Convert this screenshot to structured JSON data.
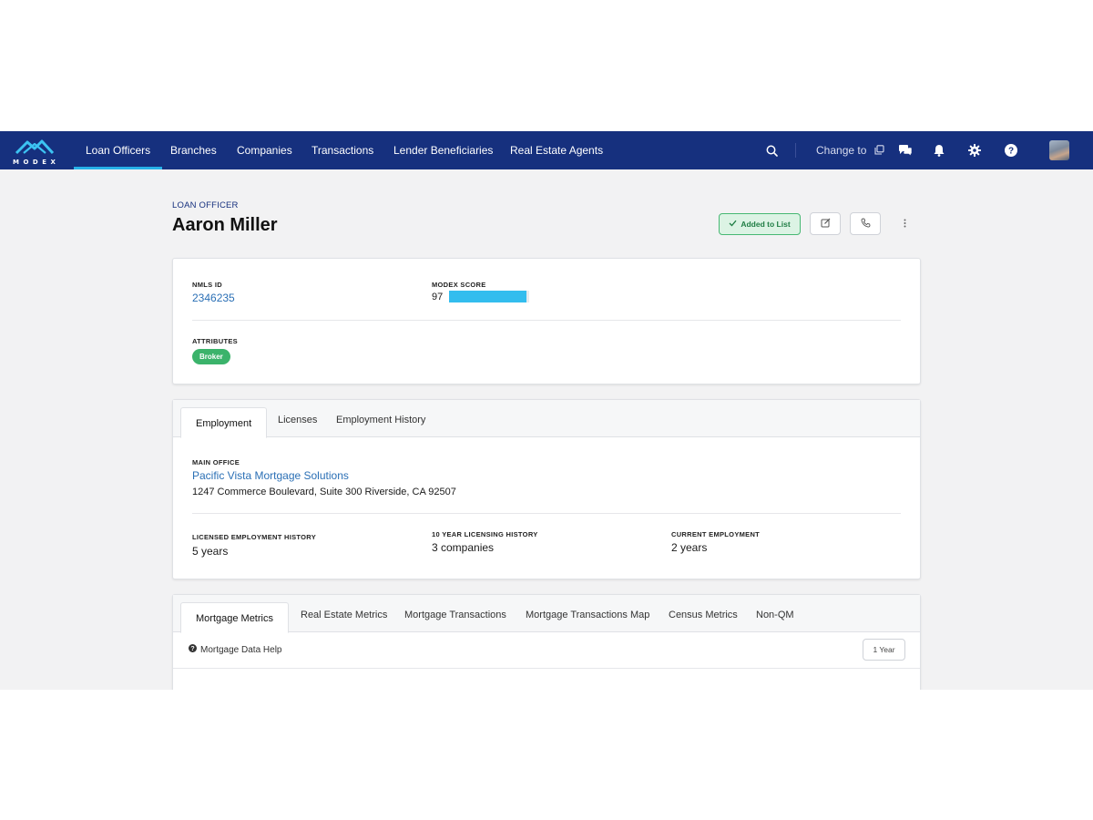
{
  "brand": {
    "name": "MODEX"
  },
  "nav": {
    "items": [
      {
        "label": "Loan Officers",
        "active": true
      },
      {
        "label": "Branches"
      },
      {
        "label": "Companies"
      },
      {
        "label": "Transactions"
      },
      {
        "label": "Lender Beneficiaries"
      },
      {
        "label": "Real Estate Agents"
      }
    ],
    "change_to": "Change to",
    "icons": [
      "search-icon",
      "copy-icon",
      "chat-icon",
      "bell-icon",
      "gear-icon",
      "help-icon"
    ]
  },
  "header": {
    "kicker": "LOAN OFFICER",
    "name": "Aaron Miller",
    "added_label": "Added to List"
  },
  "summary": {
    "nmls_label": "NMLS ID",
    "nmls_id": "2346235",
    "score_label": "MODEX SCORE",
    "score": "97",
    "score_fraction": 0.97,
    "attributes_label": "ATTRIBUTES",
    "attributes": [
      "Broker"
    ]
  },
  "employment": {
    "tabs": [
      "Employment",
      "Licenses",
      "Employment History"
    ],
    "main_office_label": "MAIN OFFICE",
    "office_name": "Pacific Vista Mortgage Solutions",
    "office_address": "1247 Commerce Boulevard, Suite 300 Riverside, CA 92507",
    "stats": [
      {
        "label": "LICENSED EMPLOYMENT HISTORY",
        "value": "5 years"
      },
      {
        "label": "10 YEAR LICENSING HISTORY",
        "value": "3 companies"
      },
      {
        "label": "CURRENT EMPLOYMENT",
        "value": "2 years"
      }
    ]
  },
  "metrics": {
    "tabs": [
      "Mortgage Metrics",
      "Real Estate Metrics",
      "Mortgage Transactions",
      "Mortgage Transactions Map",
      "Census Metrics",
      "Non-QM"
    ],
    "help_label": "Mortgage Data Help",
    "period": "1 Year"
  },
  "colors": {
    "nav_bg": "#16307e",
    "accent": "#27b0e8",
    "score_bar": "#33bdee",
    "badge_green": "#3bb36b",
    "link": "#2a6fb5"
  }
}
